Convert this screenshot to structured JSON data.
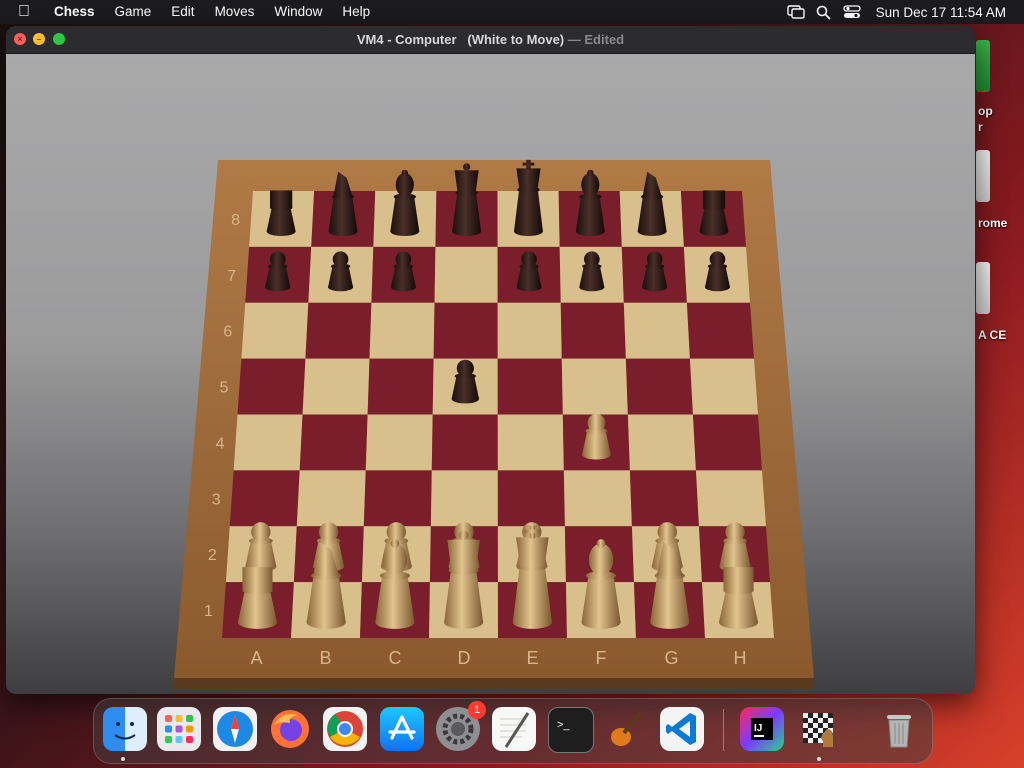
{
  "menubar": {
    "app_name": "Chess",
    "items": [
      "Game",
      "Edit",
      "Moves",
      "Window",
      "Help"
    ],
    "clock": "Sun Dec 17  11:54 AM"
  },
  "desktop_labels": [
    "op",
    "r",
    "rome",
    "A CE"
  ],
  "window": {
    "title": "VM4 - Computer   (White to Move)",
    "separator": "—",
    "status": "Edited"
  },
  "board": {
    "files": [
      "A",
      "B",
      "C",
      "D",
      "E",
      "F",
      "G",
      "H"
    ],
    "ranks": [
      "8",
      "7",
      "6",
      "5",
      "4",
      "3",
      "2",
      "1"
    ],
    "pieces": [
      {
        "square": "a8",
        "piece": "rook",
        "color": "black"
      },
      {
        "square": "b8",
        "piece": "knight",
        "color": "black"
      },
      {
        "square": "c8",
        "piece": "bishop",
        "color": "black"
      },
      {
        "square": "d8",
        "piece": "queen",
        "color": "black"
      },
      {
        "square": "e8",
        "piece": "king",
        "color": "black"
      },
      {
        "square": "f8",
        "piece": "bishop",
        "color": "black"
      },
      {
        "square": "g8",
        "piece": "knight",
        "color": "black"
      },
      {
        "square": "h8",
        "piece": "rook",
        "color": "black"
      },
      {
        "square": "a7",
        "piece": "pawn",
        "color": "black"
      },
      {
        "square": "b7",
        "piece": "pawn",
        "color": "black"
      },
      {
        "square": "c7",
        "piece": "pawn",
        "color": "black"
      },
      {
        "square": "e7",
        "piece": "pawn",
        "color": "black"
      },
      {
        "square": "f7",
        "piece": "pawn",
        "color": "black"
      },
      {
        "square": "g7",
        "piece": "pawn",
        "color": "black"
      },
      {
        "square": "h7",
        "piece": "pawn",
        "color": "black"
      },
      {
        "square": "d5",
        "piece": "pawn",
        "color": "black"
      },
      {
        "square": "f4",
        "piece": "pawn",
        "color": "white"
      },
      {
        "square": "a2",
        "piece": "pawn",
        "color": "white"
      },
      {
        "square": "b2",
        "piece": "pawn",
        "color": "white"
      },
      {
        "square": "c2",
        "piece": "pawn",
        "color": "white"
      },
      {
        "square": "d2",
        "piece": "pawn",
        "color": "white"
      },
      {
        "square": "e2",
        "piece": "pawn",
        "color": "white"
      },
      {
        "square": "g2",
        "piece": "pawn",
        "color": "white"
      },
      {
        "square": "h2",
        "piece": "pawn",
        "color": "white"
      },
      {
        "square": "a1",
        "piece": "rook",
        "color": "white"
      },
      {
        "square": "b1",
        "piece": "knight",
        "color": "white"
      },
      {
        "square": "c1",
        "piece": "bishop",
        "color": "white"
      },
      {
        "square": "d1",
        "piece": "queen",
        "color": "white"
      },
      {
        "square": "e1",
        "piece": "king",
        "color": "white"
      },
      {
        "square": "f1",
        "piece": "bishop",
        "color": "white"
      },
      {
        "square": "g1",
        "piece": "knight",
        "color": "white"
      },
      {
        "square": "h1",
        "piece": "rook",
        "color": "white"
      }
    ]
  },
  "dock": {
    "apps": [
      "finder",
      "launchpad",
      "safari",
      "firefox",
      "chrome",
      "app-store",
      "system-settings",
      "textedit",
      "terminal",
      "garageband",
      "vscode",
      "intellij-idea-ce",
      "chess",
      "trash"
    ],
    "settings_badge": "1"
  },
  "colors": {
    "light_square": "#d9bf8c",
    "dark_square": "#7a1e2c",
    "frame": "#8a5a30",
    "black_piece": "#2a1a16",
    "white_piece": "#c9a46a"
  }
}
